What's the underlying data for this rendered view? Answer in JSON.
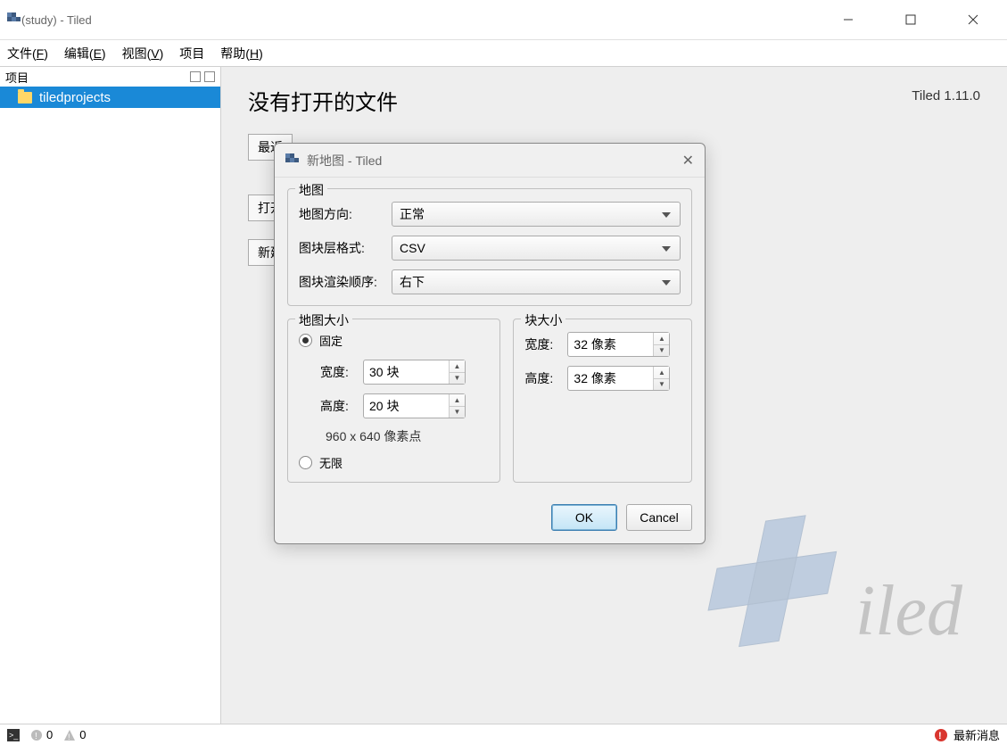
{
  "window": {
    "title": "(study) - Tiled"
  },
  "menu": {
    "file": "文件(F)",
    "edit": "编辑(E)",
    "view": "视图(V)",
    "project": "项目",
    "help": "帮助(H)"
  },
  "sidebar": {
    "title": "项目",
    "items": [
      {
        "label": "tiledprojects"
      }
    ]
  },
  "content": {
    "heading": "没有打开的文件",
    "version": "Tiled 1.11.0",
    "btn_recent": "最近",
    "btn_open": "打开",
    "btn_new": "新建"
  },
  "dialog": {
    "title": "新地图 - Tiled",
    "map_group": "地图",
    "orientation_label": "地图方向:",
    "orientation_value": "正常",
    "layer_format_label": "图块层格式:",
    "layer_format_value": "CSV",
    "render_order_label": "图块渲染顺序:",
    "render_order_value": "右下",
    "map_size_group": "地图大小",
    "tile_size_group": "块大小",
    "fixed_label": "固定",
    "infinite_label": "无限",
    "width_label": "宽度:",
    "height_label": "高度:",
    "map_width_value": "30 块",
    "map_height_value": "20 块",
    "tile_width_value": "32 像素",
    "tile_height_value": "32 像素",
    "pixel_hint": "960 x 640 像素点",
    "ok": "OK",
    "cancel": "Cancel"
  },
  "statusbar": {
    "errors": "0",
    "warnings": "0",
    "news": "最新消息"
  }
}
